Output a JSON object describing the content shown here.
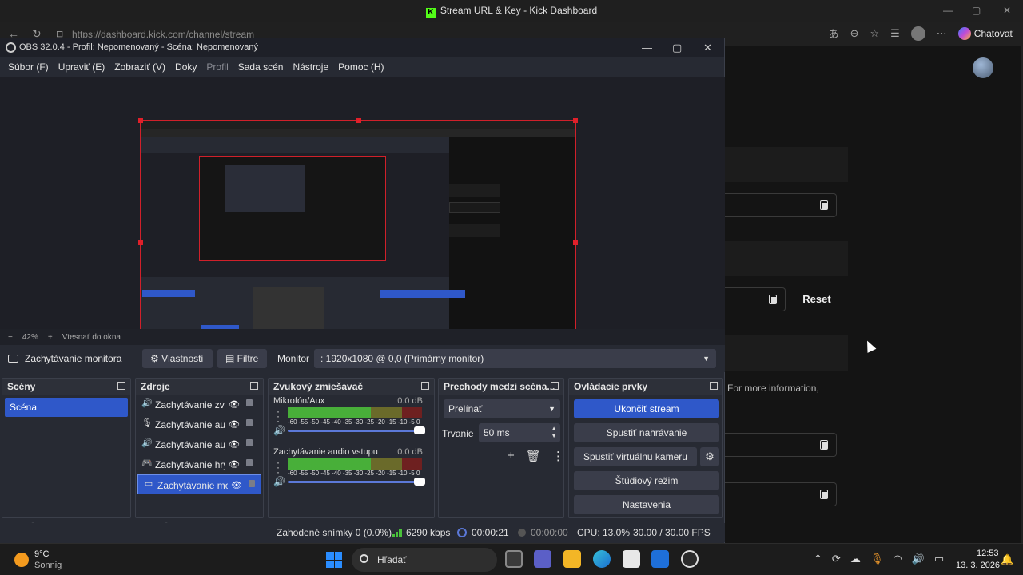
{
  "browser": {
    "title": "Stream URL & Key - Kick Dashboard",
    "url": "https://dashboard.kick.com/channel/stream",
    "copilot_label": "Chatovať"
  },
  "kick": {
    "reset_label": "Reset",
    "more_info_text": "For more information,"
  },
  "obs": {
    "title": "OBS 32.0.4 - Profil: Nepomenovaný - Scéna: Nepomenovaný",
    "menu": [
      {
        "label": "Súbor (F)",
        "disabled": false
      },
      {
        "label": "Upraviť (E)",
        "disabled": false
      },
      {
        "label": "Zobraziť (V)",
        "disabled": false
      },
      {
        "label": "Doky",
        "disabled": false
      },
      {
        "label": "Profil",
        "disabled": true
      },
      {
        "label": "Sada scén",
        "disabled": false
      },
      {
        "label": "Nástroje",
        "disabled": false
      },
      {
        "label": "Pomoc (H)",
        "disabled": false
      }
    ],
    "preview_footer": {
      "minus": "−",
      "zoom": "42%",
      "plus": "+",
      "fit_label": "Vtesnať do okna"
    },
    "source_toolbar": {
      "source_name": "Zachytávanie monitora",
      "properties_label": "Vlastnosti",
      "filters_label": "Filtre",
      "monitor_label": "Monitor",
      "monitor_value": ": 1920x1080 @ 0,0 (Primárny monitor)"
    },
    "scenes": {
      "title": "Scény",
      "items": [
        "Scéna"
      ]
    },
    "sources": {
      "title": "Zdroje",
      "items": [
        {
          "name": "Zachytávanie zvu",
          "icon": "speaker-icon",
          "glyph": "🔊"
        },
        {
          "name": "Zachytávanie auc",
          "icon": "microphone-icon",
          "glyph": "🎙"
        },
        {
          "name": "Zachytávanie auc",
          "icon": "speaker-icon",
          "glyph": "🔊"
        },
        {
          "name": "Zachytávanie hry",
          "icon": "gamepad-icon",
          "glyph": "🎮"
        },
        {
          "name": "Zachytávanie mo",
          "icon": "monitor-icon",
          "glyph": "▭"
        }
      ]
    },
    "mixer": {
      "title": "Zvukový zmiešavač",
      "scale": "-60 -55 -50 -45 -40 -35 -30 -25 -20 -15 -10 -5 0",
      "channels": [
        {
          "name": "Mikrofón/Aux",
          "db": "0.0 dB",
          "level": 0.62
        },
        {
          "name": "Zachytávanie audio vstupu",
          "db": "0.0 dB",
          "level": 0.62
        }
      ]
    },
    "transitions": {
      "title": "Prechody medzi scéna...",
      "selected": "Prelínať",
      "duration_label": "Trvanie",
      "duration_value": "50 ms"
    },
    "controls": {
      "title": "Ovládacie prvky",
      "stop_stream": "Ukončiť stream",
      "start_recording": "Spustiť nahrávanie",
      "start_vcam": "Spustiť virtuálnu kameru",
      "studio_mode": "Štúdiový režim",
      "settings": "Nastavenia"
    },
    "status": {
      "dropped_frames": "Zahodené snímky 0 (0.0%)",
      "bitrate": "6290 kbps",
      "stream_time": "00:00:21",
      "record_time": "00:00:00",
      "cpu": "CPU: 13.0%",
      "fps": "30.00 / 30.00 FPS"
    }
  },
  "taskbar": {
    "weather_temp": "9°C",
    "weather_desc": "Sonnig",
    "search_placeholder": "Hľadať",
    "time": "12:53",
    "date": "13. 3. 2026"
  }
}
